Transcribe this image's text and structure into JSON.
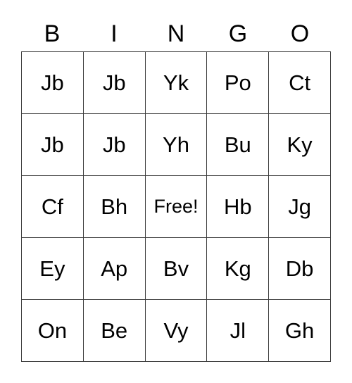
{
  "card": {
    "header_letters": [
      "B",
      "I",
      "N",
      "G",
      "O"
    ],
    "rows": [
      [
        "Jb",
        "Jb",
        "Yk",
        "Po",
        "Ct"
      ],
      [
        "Jb",
        "Jb",
        "Yh",
        "Bu",
        "Ky"
      ],
      [
        "Cf",
        "Bh",
        "Free!",
        "Hb",
        "Jg"
      ],
      [
        "Ey",
        "Ap",
        "Bv",
        "Kg",
        "Db"
      ],
      [
        "On",
        "Be",
        "Vy",
        "Jl",
        "Gh"
      ]
    ],
    "free_space": {
      "row": 2,
      "column": 2,
      "label": "Free!"
    },
    "colors": {
      "background": "#ffffff",
      "text": "#000000",
      "grid_line": "#3c3c3c"
    }
  }
}
